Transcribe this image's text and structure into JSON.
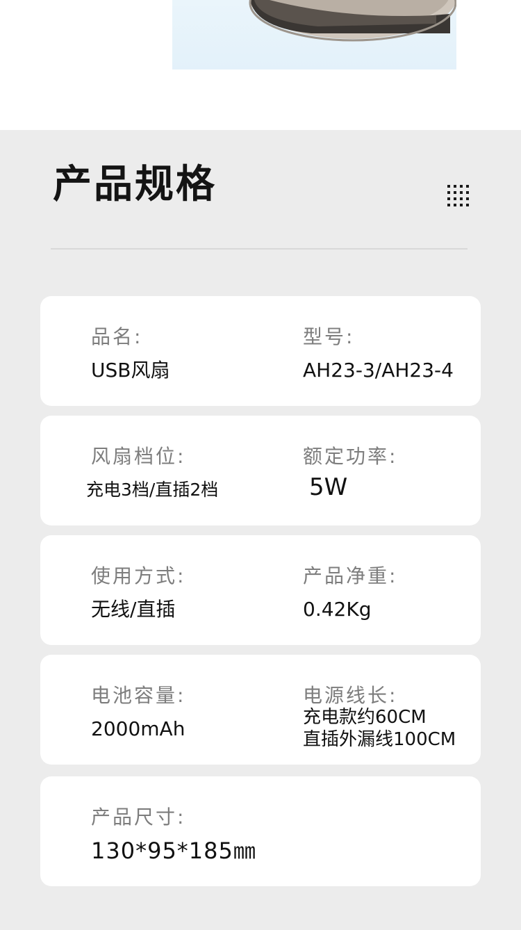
{
  "header": {
    "title": "产品规格"
  },
  "specs": [
    {
      "left": {
        "label": "品名:",
        "value": "USB风扇"
      },
      "right": {
        "label": "型号:",
        "value": "AH23-3/AH23-4"
      }
    },
    {
      "left": {
        "label": "风扇档位:",
        "value": "充电3档/直插2档"
      },
      "right": {
        "label": "额定功率:",
        "value": "5W"
      }
    },
    {
      "left": {
        "label": "使用方式:",
        "value": "无线/直插"
      },
      "right": {
        "label": "产品净重:",
        "value": "0.42Kg"
      }
    },
    {
      "left": {
        "label": "电池容量:",
        "value": "2000mAh"
      },
      "right": {
        "label": "电源线长:",
        "value_line1": "充电款约60CM",
        "value_line2": "直插外漏线100CM"
      }
    },
    {
      "left": {
        "label": "产品尺寸:",
        "value": "130*95*185㎜"
      }
    }
  ],
  "icons": {
    "grid": "grid-dots-icon"
  }
}
